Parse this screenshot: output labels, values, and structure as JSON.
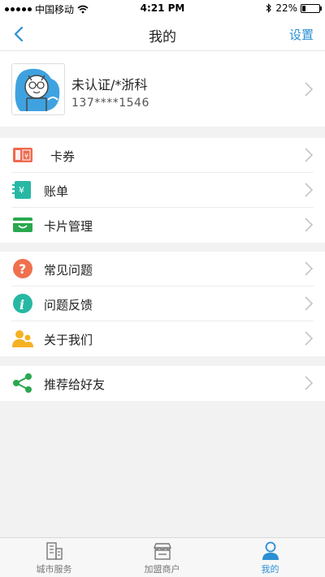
{
  "status_bar": {
    "carrier": "中国移动",
    "time": "4:21 PM",
    "battery": "22%",
    "battery_level": 0.22
  },
  "nav": {
    "title": "我的",
    "settings_label": "设置",
    "back_icon": "chevron-left-icon"
  },
  "profile": {
    "name": "未认证/*浙科",
    "phone": "137****1546"
  },
  "menu_groups": [
    {
      "items": [
        {
          "label": "卡券",
          "icon": "coupon-icon",
          "color": "#ef6a4f"
        },
        {
          "label": "账单",
          "icon": "bill-icon",
          "color": "#27b8a4"
        },
        {
          "label": "卡片管理",
          "icon": "card-icon",
          "color": "#2aa84f"
        }
      ]
    },
    {
      "items": [
        {
          "label": "常见问题",
          "icon": "question-icon",
          "color": "#f0704e"
        },
        {
          "label": "问题反馈",
          "icon": "info-icon",
          "color": "#27b8a4"
        },
        {
          "label": "关于我们",
          "icon": "people-icon",
          "color": "#f5b123"
        }
      ]
    },
    {
      "items": [
        {
          "label": "推荐给好友",
          "icon": "share-icon",
          "color": "#2aa84f"
        }
      ]
    }
  ],
  "tabbar": {
    "tabs": [
      {
        "label": "城市服务",
        "icon": "building-icon",
        "active": false
      },
      {
        "label": "加盟商户",
        "icon": "store-icon",
        "active": false
      },
      {
        "label": "我的",
        "icon": "person-icon",
        "active": true
      }
    ],
    "accent": "#2a8fd3"
  }
}
